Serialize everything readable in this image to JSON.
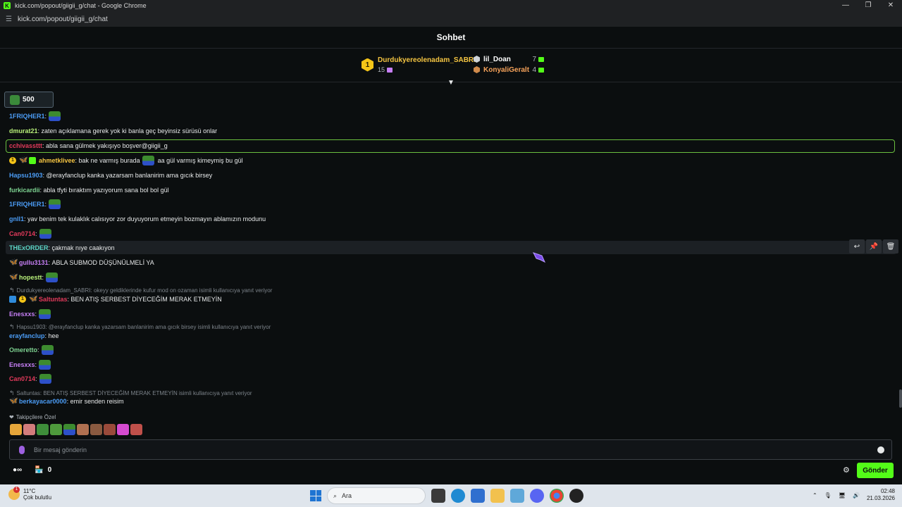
{
  "window": {
    "title": "kick.com/popout/giigii_g/chat - Google Chrome",
    "url": "kick.com/popout/giigii_g/chat"
  },
  "chat": {
    "header": "Sohbet",
    "leaderboard": {
      "first": {
        "rank": "1",
        "name": "Durdukyereolenadam_SABRI",
        "count": "15"
      },
      "others": [
        {
          "name": "lil_Doan",
          "count": "7"
        },
        {
          "name": "KonyaliGeralt",
          "count": "4"
        }
      ]
    },
    "kick_count": "500",
    "messages": [
      {
        "user": "1FRIQHER1",
        "text": "",
        "color": "#4b9cf5",
        "emote": true
      },
      {
        "user": "dmurat21",
        "text": "zaten açıklamana gerek yok ki banla geç beyinsiz sürüsü onlar",
        "color": "#b8f07a"
      },
      {
        "user": "cchivassttt",
        "text": "abla sana gülmek yakışıyo boşver@giigii_g",
        "color": "#e23a5b"
      },
      {
        "user": "ahmetklivee",
        "text": "bak ne varmış burada",
        "text2": "aa gül varmış kimeymiş bu gül",
        "color": "#f5c542"
      },
      {
        "user": "Hapsu1903",
        "text": "@erayfanclup kanka yazarsam banlanirim ama gıcık birsey",
        "color": "#4b9cf5"
      },
      {
        "user": "furkicardii",
        "text": "abla tfyti bıraktım yazıyorum sana bol bol gül",
        "color": "#7ed492"
      },
      {
        "user": "1FRIQHER1",
        "text": "",
        "color": "#4b9cf5",
        "emote": true
      },
      {
        "user": "gnll1",
        "text": "yav benim tek kulaklık calısıyor zor duyuyorum etmeyin bozmayın ablamızın modunu",
        "color": "#4b9cf5"
      },
      {
        "user": "Can0714",
        "text": "",
        "color": "#e23a5b",
        "emote": true
      },
      {
        "user": "THExORDER",
        "text": "çakmak nıye caakıyon",
        "color": "#5cd6c7"
      },
      {
        "user": "gullu3131",
        "text": "ABLA SUBMOD DÜŞÜNÜLMELİ YA",
        "color": "#c67ff5"
      },
      {
        "user": "hopestt",
        "text": "",
        "color": "#b8f07a",
        "emote": true
      },
      {
        "user": "Saltuntas",
        "text": "BEN ATIŞ SERBEST DİYECEĞİM MERAK ETMEYİN",
        "color": "#e23a5b"
      },
      {
        "user": "Enesxxs",
        "text": "",
        "color": "#c67ff5",
        "emote": true
      },
      {
        "user": "erayfanclup",
        "text": "hee",
        "color": "#4b9cf5"
      },
      {
        "user": "Omeretto",
        "text": "",
        "color": "#7ed492",
        "emote": true
      },
      {
        "user": "Enesxxs",
        "text": "",
        "color": "#c67ff5",
        "emote": true
      },
      {
        "user": "Can0714",
        "text": "",
        "color": "#e23a5b",
        "emote": true
      },
      {
        "user": "berkayacar0000",
        "text": "emir senden reisim",
        "color": "#4b9cf5"
      }
    ],
    "replies": [
      "Durdukyereolenadam_SABRI: okeyy geldiklerinde kufur mod on ozaman isimli kullanıcıya yanıt veriyor",
      "Hapsu1903: @erayfanclup kanka yazarsam banlanirim ama gıcık birsey isimli kullanıcıya yanıt veriyor",
      "Saltuntas: BEN ATIŞ SERBEST DİYECEĞİM MERAK ETMEYİN isimli kullanıcıya yanıt veriyor"
    ],
    "followers_label": "Takipçilere Özel",
    "input_placeholder": "Bir mesaj gönderin",
    "points": "0",
    "send_label": "Gönder"
  },
  "taskbar": {
    "temp": "11°C",
    "weather": "Çok bulutlu",
    "search": "Ara",
    "time": "02:48",
    "date": "21.03.2026",
    "weather_badge": "1"
  },
  "colors": {
    "accent": "#53fc18",
    "highlight_border": "#6bbf3f"
  }
}
